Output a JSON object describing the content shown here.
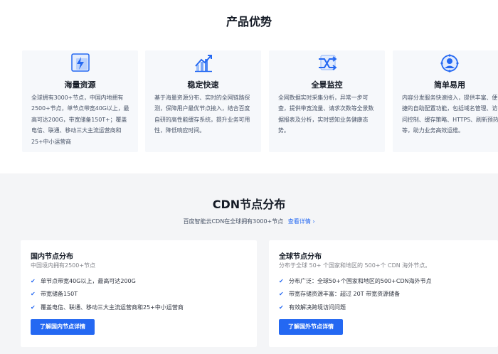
{
  "advantages": {
    "title": "产品优势",
    "cards": [
      {
        "title": "海量资源",
        "desc": "全球拥有3000+节点，中国内地拥有2500+节点，单节点带宽40G以上，最高可达200G，带宽储备150T+；覆盖电信、联通、移动三大主流运营商和25+中小运营商",
        "icon": "lightning-screen-icon"
      },
      {
        "title": "稳定快速",
        "desc": "基于海量资源分布、实时的全网链路探测，保障用户最优节点接入，结合百度自研的高性能缓存系统，提升业务可用性，降低响应时间。",
        "icon": "chart-growth-icon"
      },
      {
        "title": "全景监控",
        "desc": "全网数据实时采集分析，异常一步可查，提供带宽流量、请求次数等全景数据报表及分析，实时感知业务健康态势。",
        "icon": "monitor-arrows-icon"
      },
      {
        "title": "简单易用",
        "desc": "内容分发服务快速接入，提供丰富、便捷的自助配置功能，包括域名管理、访问控制、缓存策略、HTTPS、刷新预热等，助力业务高效运维。",
        "icon": "user-gear-icon"
      }
    ]
  },
  "cdn": {
    "title": "CDN节点分布",
    "subtitle": "百度智能云CDN在全球拥有3000+节点",
    "link": "查看详情",
    "link_arrow": "›",
    "domestic": {
      "title": "国内节点分布",
      "subtitle": "中国境内拥有2500+节点",
      "items": [
        "单节点带宽40G以上，最高可达200G",
        "带宽储备150T",
        "覆盖电信、联通、移动三大主流运营商和25+中小运营商"
      ],
      "button": "了解国内节点详情"
    },
    "overseas": {
      "title": "全球节点分布",
      "subtitle": "分布于全球 50+ 个国家和地区的 500+个 CDN 海外节点。",
      "items": [
        "分布广泛：全球50+个国家和地区的500+CDN海外节点",
        "带宽存储资源丰富：超过 20T 带宽资源储备",
        "有效解决跨境访问问题"
      ],
      "button": "了解国外节点详情"
    }
  },
  "check_glyph": "✔",
  "colors": {
    "accent": "#2468f2",
    "section_bg": "#f4f5f7",
    "card_bg": "#f6f8fb"
  }
}
